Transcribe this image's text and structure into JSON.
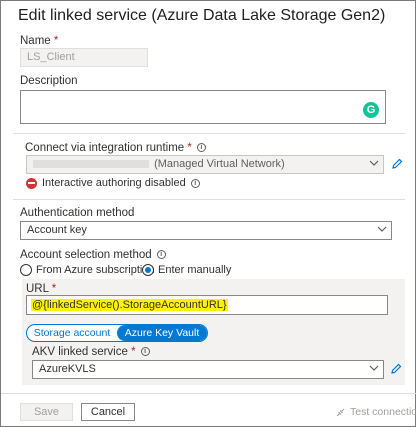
{
  "panel": {
    "title": "Edit linked service (Azure Data Lake Storage Gen2)"
  },
  "name": {
    "label": "Name",
    "required_marker": "*",
    "value": "LS_Client"
  },
  "description": {
    "label": "Description",
    "value": ""
  },
  "integration_runtime": {
    "label": "Connect via integration runtime",
    "required_marker": "*",
    "selected_value": "(Managed Virtual Network)",
    "warning": "Interactive authoring disabled"
  },
  "authentication": {
    "label": "Authentication method",
    "selected_value": "Account key"
  },
  "account_selection": {
    "label": "Account selection method",
    "options": [
      "From Azure subscription",
      "Enter manually"
    ],
    "selected_index": 1
  },
  "url": {
    "label": "URL",
    "required_marker": "*",
    "value": "@{linkedService().StorageAccountURL}"
  },
  "secret_source": {
    "tabs": [
      "Storage account key",
      "Azure Key Vault"
    ],
    "selected_index": 1
  },
  "akv_linked_service": {
    "label": "AKV linked service",
    "required_marker": "*",
    "selected_value": "AzureKVLS"
  },
  "footer": {
    "save_label": "Save",
    "cancel_label": "Cancel",
    "test_connection_label": "Test connection"
  },
  "colors": {
    "accent": "#0078d4",
    "error": "#d13438",
    "highlight": "#fff200",
    "grammarly": "#15c39a"
  },
  "icons": [
    "info-icon",
    "pencil-icon",
    "chevron-down-icon",
    "error-stop-icon",
    "grammarly-icon",
    "test-connection-icon"
  ]
}
